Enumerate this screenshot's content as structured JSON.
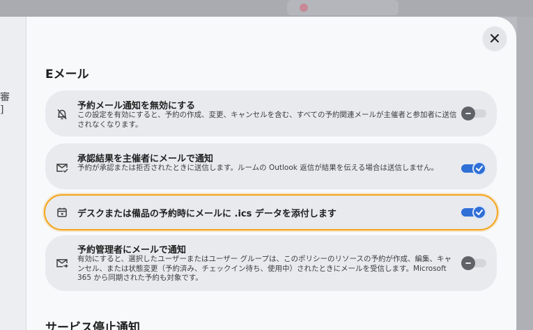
{
  "background": {
    "left_text_1": "審",
    "left_text_2": "]"
  },
  "dialog": {
    "close_icon": "close-icon",
    "section_email_title": "Eメール",
    "rows": [
      {
        "icon": "bell-off-icon",
        "title": "予約メール通知を無効にする",
        "description": "この設定を有効にすると、予約の作成、変更、キャンセルを含む、すべての予約関連メールが主催者と参加者に送信されなくなります。",
        "enabled": false
      },
      {
        "icon": "mail-check-icon",
        "title": "承認結果を主催者にメールで通知",
        "description": "予約が承認または拒否されたときに送信します。ルームの Outlook 返信が結果を伝える場合は送信しません。",
        "enabled": true
      },
      {
        "icon": "calendar-icon",
        "title": "デスクまたは備品の予約時にメールに .ics データを添付します",
        "description": "",
        "enabled": true
      },
      {
        "icon": "mail-forward-icon",
        "title": "予約管理者にメールで通知",
        "description": "有効にすると、選択したユーザーまたはユーザー グループは、このポリシーのリソースの予約が作成、編集、キャンセル、または状態変更（予約済み、チェックイン待ち、使用中）されたときにメールを受信します。Microsoft 365 から同期された予約も対象です。",
        "enabled": false
      }
    ],
    "section_outage_title": "サービス停止通知"
  },
  "colors": {
    "accent": "#2f6fd6",
    "highlight": "#f4a51c",
    "row_bg": "#e8eaee"
  }
}
